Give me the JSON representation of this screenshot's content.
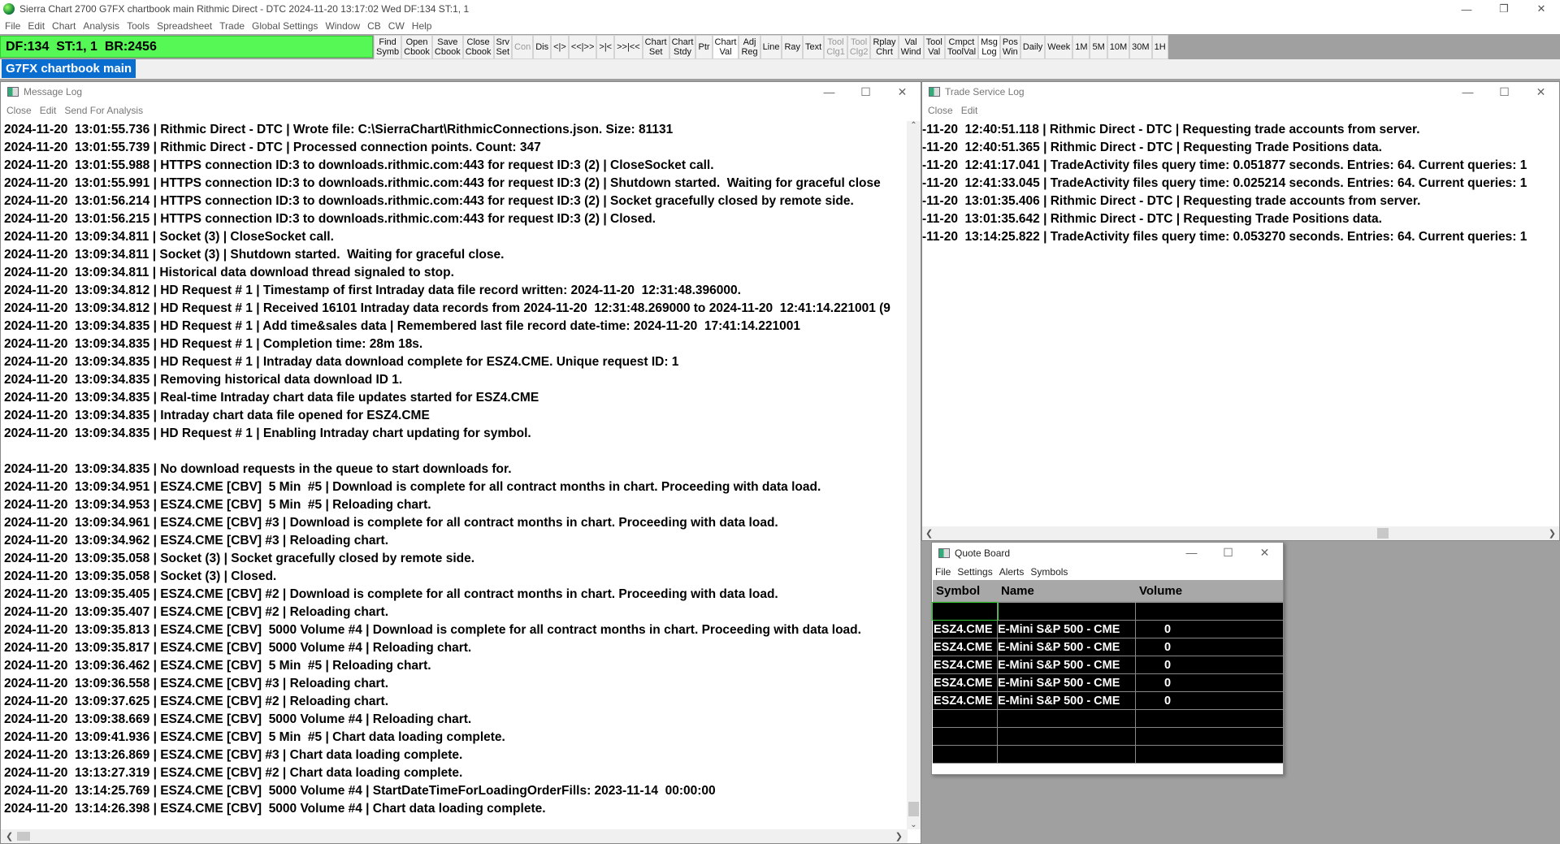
{
  "app": {
    "title": "Sierra Chart 2700 G7FX chartbook main Rithmic Direct - DTC 2024-11-20  13:17:02 Wed DF:134  ST:1, 1",
    "menu": [
      "File",
      "Edit",
      "Chart",
      "Analysis",
      "Tools",
      "Spreadsheet",
      "Trade",
      "Global Settings",
      "Window",
      "CB",
      "CW",
      "Help"
    ],
    "status": "DF:134  ST:1, 1  BR:2456",
    "status_color": "#55f855",
    "toolbar": [
      {
        "label": "Find\nSymb"
      },
      {
        "label": "Open\nCbook"
      },
      {
        "label": "Save\nCbook"
      },
      {
        "label": "Close\nCbook"
      },
      {
        "label": "Srv\nSet"
      },
      {
        "label": "Con",
        "disabled": true
      },
      {
        "label": "Dis"
      },
      {
        "label": "<|>"
      },
      {
        "label": "<<|>>"
      },
      {
        "label": ">|<"
      },
      {
        "label": ">>|<<"
      },
      {
        "label": "Chart\nSet"
      },
      {
        "label": "Chart\nStdy"
      },
      {
        "label": "Ptr"
      },
      {
        "label": "Chart\nVal",
        "active": true
      },
      {
        "label": "Adj\nReg"
      },
      {
        "label": "Line"
      },
      {
        "label": "Ray"
      },
      {
        "label": "Text"
      },
      {
        "label": "Tool\nClg1",
        "disabled": true
      },
      {
        "label": "Tool\nClg2",
        "disabled": true
      },
      {
        "label": "Rplay\nChrt"
      },
      {
        "label": "Val\nWind"
      },
      {
        "label": "Tool\nVal"
      },
      {
        "label": "Cmpct\nToolVal"
      },
      {
        "label": "Msg\nLog",
        "active": true
      },
      {
        "label": "Pos\nWin"
      },
      {
        "label": "Daily"
      },
      {
        "label": "Week"
      },
      {
        "label": "1M"
      },
      {
        "label": "5M"
      },
      {
        "label": "10M"
      },
      {
        "label": "30M"
      },
      {
        "label": "1H"
      }
    ],
    "chartbook_tab": "G7FX chartbook main"
  },
  "message_log": {
    "title": "Message Log",
    "menu": [
      "Close",
      "Edit",
      "Send For Analysis"
    ],
    "lines": [
      "2024-11-20  13:01:55.736 | Rithmic Direct - DTC | Wrote file: C:\\SierraChart\\RithmicConnections.json. Size: 81131",
      "2024-11-20  13:01:55.739 | Rithmic Direct - DTC | Processed connection points. Count: 347",
      "2024-11-20  13:01:55.988 | HTTPS connection ID:3 to downloads.rithmic.com:443 for request ID:3 (2) | CloseSocket call.",
      "2024-11-20  13:01:55.991 | HTTPS connection ID:3 to downloads.rithmic.com:443 for request ID:3 (2) | Shutdown started.  Waiting for graceful close",
      "2024-11-20  13:01:56.214 | HTTPS connection ID:3 to downloads.rithmic.com:443 for request ID:3 (2) | Socket gracefully closed by remote side.",
      "2024-11-20  13:01:56.215 | HTTPS connection ID:3 to downloads.rithmic.com:443 for request ID:3 (2) | Closed.",
      "2024-11-20  13:09:34.811 | Socket (3) | CloseSocket call.",
      "2024-11-20  13:09:34.811 | Socket (3) | Shutdown started.  Waiting for graceful close.",
      "2024-11-20  13:09:34.811 | Historical data download thread signaled to stop.",
      "2024-11-20  13:09:34.812 | HD Request # 1 | Timestamp of first Intraday data file record written: 2024-11-20  12:31:48.396000.",
      "2024-11-20  13:09:34.812 | HD Request # 1 | Received 16101 Intraday data records from 2024-11-20  12:31:48.269000 to 2024-11-20  12:41:14.221001 (9",
      "2024-11-20  13:09:34.835 | HD Request # 1 | Add time&sales data | Remembered last file record date-time: 2024-11-20  17:41:14.221001",
      "2024-11-20  13:09:34.835 | HD Request # 1 | Completion time: 28m 18s.",
      "2024-11-20  13:09:34.835 | HD Request # 1 | Intraday data download complete for ESZ4.CME. Unique request ID: 1",
      "2024-11-20  13:09:34.835 | Removing historical data download ID 1.",
      "2024-11-20  13:09:34.835 | Real-time Intraday chart data file updates started for ESZ4.CME",
      "2024-11-20  13:09:34.835 | Intraday chart data file opened for ESZ4.CME",
      "2024-11-20  13:09:34.835 | HD Request # 1 | Enabling Intraday chart updating for symbol.",
      "",
      "2024-11-20  13:09:34.835 | No download requests in the queue to start downloads for.",
      "2024-11-20  13:09:34.951 | ESZ4.CME [CBV]  5 Min  #5 | Download is complete for all contract months in chart. Proceeding with data load.",
      "2024-11-20  13:09:34.953 | ESZ4.CME [CBV]  5 Min  #5 | Reloading chart.",
      "2024-11-20  13:09:34.961 | ESZ4.CME [CBV] #3 | Download is complete for all contract months in chart. Proceeding with data load.",
      "2024-11-20  13:09:34.962 | ESZ4.CME [CBV] #3 | Reloading chart.",
      "2024-11-20  13:09:35.058 | Socket (3) | Socket gracefully closed by remote side.",
      "2024-11-20  13:09:35.058 | Socket (3) | Closed.",
      "2024-11-20  13:09:35.405 | ESZ4.CME [CBV] #2 | Download is complete for all contract months in chart. Proceeding with data load.",
      "2024-11-20  13:09:35.407 | ESZ4.CME [CBV] #2 | Reloading chart.",
      "2024-11-20  13:09:35.813 | ESZ4.CME [CBV]  5000 Volume #4 | Download is complete for all contract months in chart. Proceeding with data load.",
      "2024-11-20  13:09:35.817 | ESZ4.CME [CBV]  5000 Volume #4 | Reloading chart.",
      "2024-11-20  13:09:36.462 | ESZ4.CME [CBV]  5 Min  #5 | Reloading chart.",
      "2024-11-20  13:09:36.558 | ESZ4.CME [CBV] #3 | Reloading chart.",
      "2024-11-20  13:09:37.625 | ESZ4.CME [CBV] #2 | Reloading chart.",
      "2024-11-20  13:09:38.669 | ESZ4.CME [CBV]  5000 Volume #4 | Reloading chart.",
      "2024-11-20  13:09:41.936 | ESZ4.CME [CBV]  5 Min  #5 | Chart data loading complete.",
      "2024-11-20  13:13:26.869 | ESZ4.CME [CBV] #3 | Chart data loading complete.",
      "2024-11-20  13:13:27.319 | ESZ4.CME [CBV] #2 | Chart data loading complete.",
      "2024-11-20  13:14:25.769 | ESZ4.CME [CBV]  5000 Volume #4 | StartDateTimeForLoadingOrderFills: 2023-11-14  00:00:00",
      "2024-11-20  13:14:26.398 | ESZ4.CME [CBV]  5000 Volume #4 | Chart data loading complete."
    ]
  },
  "trade_log": {
    "title": "Trade Service Log",
    "menu": [
      "Close",
      "Edit"
    ],
    "lines": [
      "-11-20  12:40:51.118 | Rithmic Direct - DTC | Requesting trade accounts from server.",
      "-11-20  12:40:51.365 | Rithmic Direct - DTC | Requesting Trade Positions data.",
      "-11-20  12:41:17.041 | TradeActivity files query time: 0.051877 seconds. Entries: 64. Current queries: 1",
      "-11-20  12:41:33.045 | TradeActivity files query time: 0.025214 seconds. Entries: 64. Current queries: 1",
      "-11-20  13:01:35.406 | Rithmic Direct - DTC | Requesting trade accounts from server.",
      "-11-20  13:01:35.642 | Rithmic Direct - DTC | Requesting Trade Positions data.",
      "-11-20  13:14:25.822 | TradeActivity files query time: 0.053270 seconds. Entries: 64. Current queries: 1"
    ]
  },
  "quote_board": {
    "title": "Quote Board",
    "menu": [
      "File",
      "Settings",
      "Alerts",
      "Symbols"
    ],
    "columns": [
      "Symbol",
      "Name",
      "Volume"
    ],
    "rows": [
      [
        "",
        "",
        ""
      ],
      [
        "ESZ4.CME",
        "E-Mini S&P 500 - CME",
        "0"
      ],
      [
        "ESZ4.CME",
        "E-Mini S&P 500 - CME",
        "0"
      ],
      [
        "ESZ4.CME",
        "E-Mini S&P 500 - CME",
        "0"
      ],
      [
        "ESZ4.CME",
        "E-Mini S&P 500 - CME",
        "0"
      ],
      [
        "ESZ4.CME",
        "E-Mini S&P 500 - CME",
        "0"
      ],
      [
        "",
        "",
        ""
      ],
      [
        "",
        "",
        ""
      ],
      [
        "",
        "",
        ""
      ]
    ]
  }
}
